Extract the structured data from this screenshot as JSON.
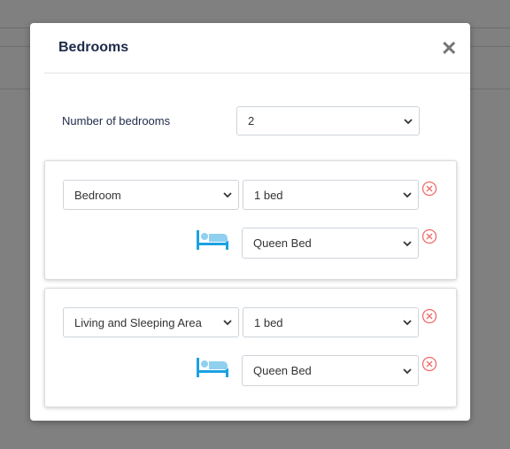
{
  "modal": {
    "title": "Bedrooms",
    "close_icon": "close-icon"
  },
  "count": {
    "label": "Number of bedrooms",
    "value": "2"
  },
  "bedrooms": [
    {
      "type": "Bedroom",
      "beds_count": "1 bed",
      "bed_type": "Queen Bed"
    },
    {
      "type": "Living and Sleeping Area",
      "beds_count": "1 bed",
      "bed_type": "Queen Bed"
    }
  ],
  "colors": {
    "accent": "#1ba1e2",
    "remove": "#f06a6a",
    "title": "#1d2b4a"
  }
}
